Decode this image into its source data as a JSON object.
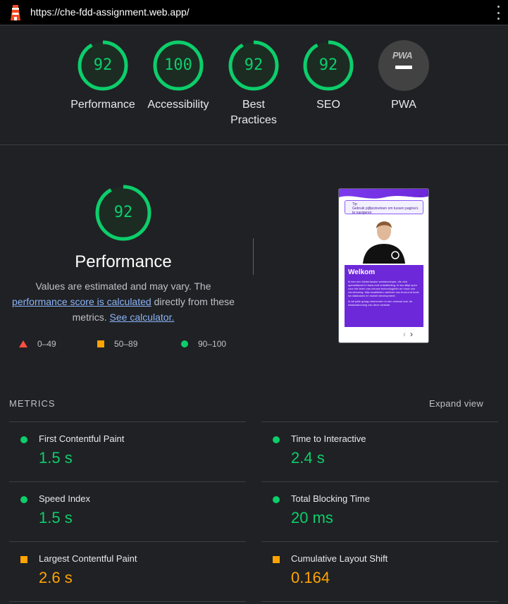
{
  "topbar": {
    "url": "https://che-fdd-assignment.web.app/"
  },
  "summary": {
    "gauges": [
      {
        "score": "92",
        "label": "Performance"
      },
      {
        "score": "100",
        "label": "Accessibility"
      },
      {
        "score": "92",
        "label": "Best Practices",
        "label_line1": "Best",
        "label_line2": "Practices"
      },
      {
        "score": "92",
        "label": "SEO"
      }
    ],
    "pwa": {
      "logo": "PWA",
      "label": "PWA"
    }
  },
  "performance": {
    "score": "92",
    "title": "Performance",
    "desc_pre": "Values are estimated and may vary. The ",
    "desc_link1": "performance score is calculated",
    "desc_mid": " directly from these metrics. ",
    "desc_link2": "See calculator.",
    "legend": [
      {
        "icon": "triangle-red",
        "range": "0–49"
      },
      {
        "icon": "square-orange",
        "range": "50–89"
      },
      {
        "icon": "circle-green",
        "range": "90–100"
      }
    ]
  },
  "thumbnail": {
    "tip_title": "Tip",
    "tip_text": "Gebruik pijltjestoetsen om tussen pagina's te navigeren",
    "card_title": "Welkom",
    "card_text1": "Ik ben een Nederlandse webdeveloper, die zich specialiseert in back-end ontwikkeling. Ik sta altijd open voor het leren van nieuwe technologieën en houd van vernieuwing. Mijn kwaliteiten variëren van front-end tools tot databases en mobiel development.",
    "card_text2": "Ik wil jullie graag meenemen in een verhaal over de totstandkoming van deze website.",
    "nav_prev": "‹",
    "nav_next": "›"
  },
  "metrics": {
    "title": "METRICS",
    "expand_label": "Expand view",
    "items": [
      {
        "name": "First Contentful Paint",
        "value": "1.5 s",
        "rating": "good"
      },
      {
        "name": "Time to Interactive",
        "value": "2.4 s",
        "rating": "good"
      },
      {
        "name": "Speed Index",
        "value": "1.5 s",
        "rating": "good"
      },
      {
        "name": "Total Blocking Time",
        "value": "20 ms",
        "rating": "good"
      },
      {
        "name": "Largest Contentful Paint",
        "value": "2.6 s",
        "rating": "average"
      },
      {
        "name": "Cumulative Layout Shift",
        "value": "0.164",
        "rating": "average"
      }
    ]
  },
  "colors": {
    "pass": "#0cce6b",
    "average": "#ffa400",
    "fail": "#ff4e42",
    "link": "#8ab4f8",
    "background": "#202124"
  }
}
